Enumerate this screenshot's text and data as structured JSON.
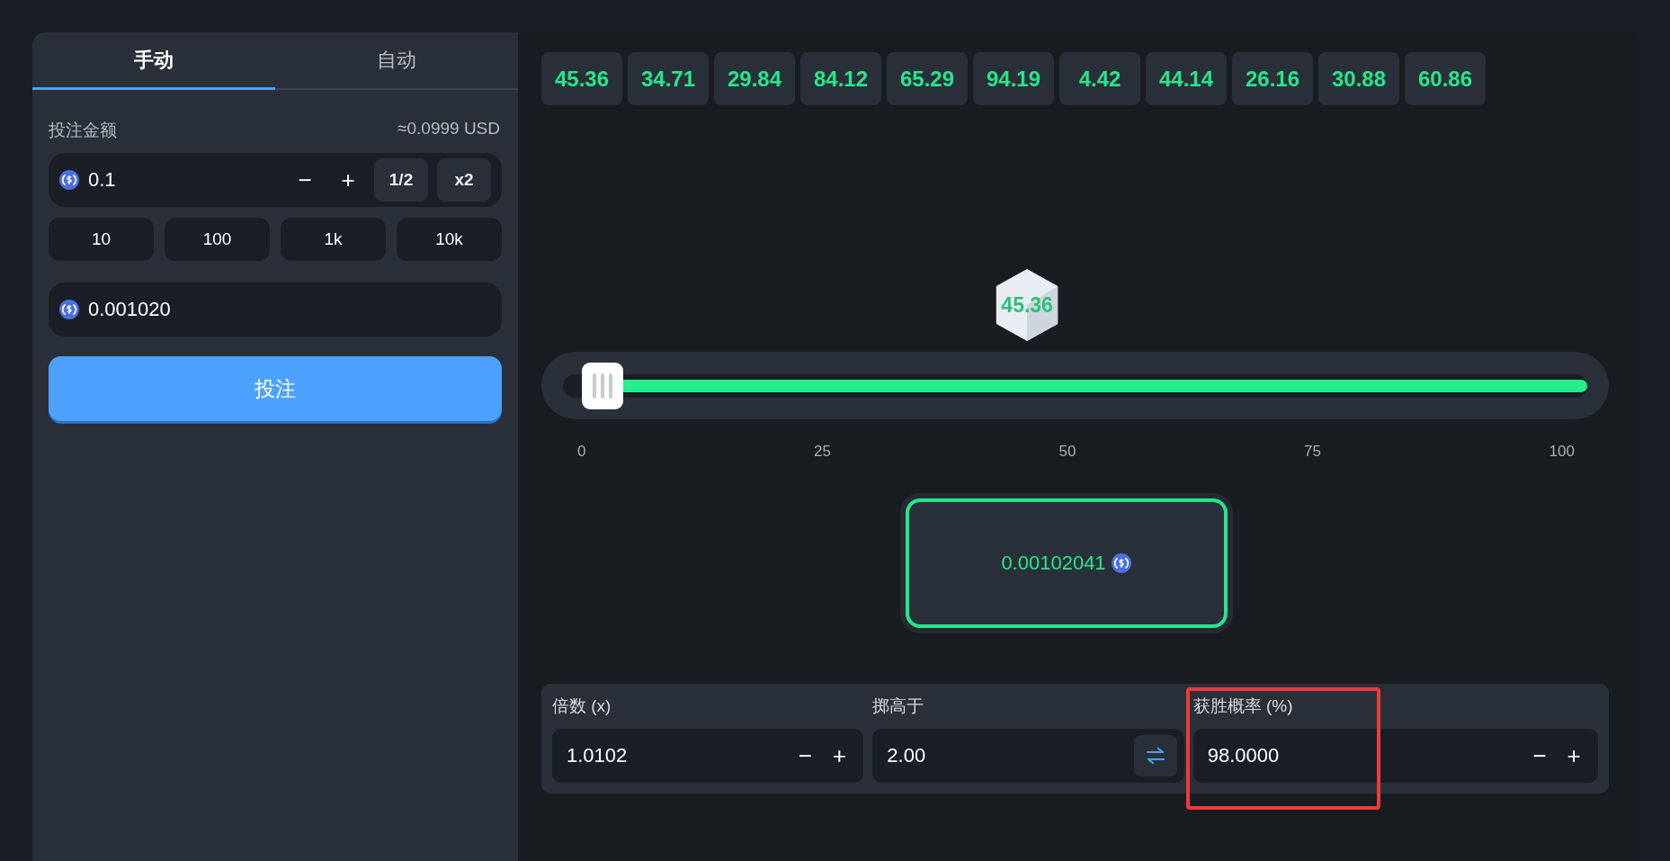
{
  "tabs": [
    {
      "label": "手动",
      "selected": true
    },
    {
      "label": "自动",
      "selected": false
    }
  ],
  "bet": {
    "label": "投注金额",
    "usd": "≈0.0999 USD",
    "amount": "0.1",
    "minus": "−",
    "plus": "+",
    "half": "1/2",
    "double": "x2"
  },
  "quick_amounts": [
    "10",
    "100",
    "1k",
    "10k"
  ],
  "payout_field": {
    "value": "0.001020"
  },
  "bet_button": "投注",
  "history": [
    "45.36",
    "34.71",
    "29.84",
    "84.12",
    "65.29",
    "94.19",
    "4.42",
    "44.14",
    "26.16",
    "30.88",
    "60.86"
  ],
  "dice": {
    "value": "45.36"
  },
  "slider": {
    "level": 0.98,
    "ticks": [
      "0",
      "25",
      "50",
      "75",
      "100"
    ]
  },
  "result_card": {
    "amount": "0.00102041"
  },
  "controls": [
    {
      "kind": "stepper",
      "label": "倍数 (x)",
      "value": "1.0102",
      "minus": "−",
      "plus": "+",
      "highlighted": false
    },
    {
      "kind": "swap",
      "label": "掷高于",
      "value": "2.00",
      "highlighted": false
    },
    {
      "kind": "stepper",
      "label": "获胜概率 (%)",
      "value": "98.0000",
      "minus": "−",
      "plus": "+",
      "highlighted": true
    }
  ]
}
